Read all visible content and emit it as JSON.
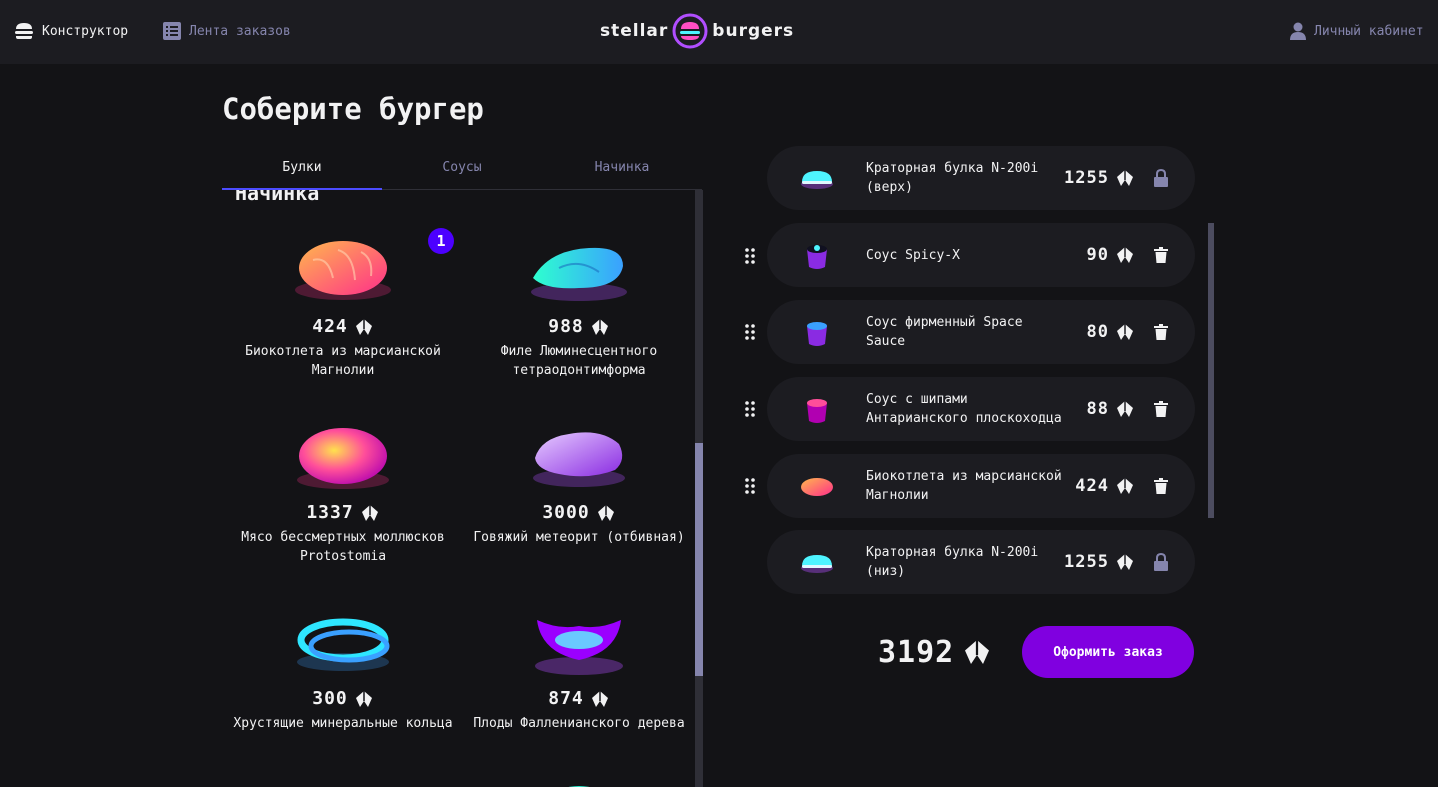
{
  "header": {
    "constructor_label": "Конструктор",
    "feed_label": "Лента заказов",
    "logo_left": "stellar",
    "logo_right": "burgers",
    "account_label": "Личный кабинет"
  },
  "main": {
    "title": "Соберите бургер",
    "tabs": [
      {
        "label": "Булки",
        "active": true
      },
      {
        "label": "Соусы",
        "active": false
      },
      {
        "label": "Начинка",
        "active": false
      }
    ],
    "section_title": "Начинка",
    "ingredients": [
      {
        "name": "Биокотлета из марсианской Магнолии",
        "price": "424",
        "count": "1"
      },
      {
        "name": "Филе Люминесцентного тетраодонтимформа",
        "price": "988"
      },
      {
        "name": "Мясо бессмертных моллюсков Protostomia",
        "price": "1337"
      },
      {
        "name": "Говяжий метеорит (отбивная)",
        "price": "3000"
      },
      {
        "name": "Хрустящие минеральные кольца",
        "price": "300"
      },
      {
        "name": "Плоды Фалленианского дерева",
        "price": "874"
      }
    ]
  },
  "constructor": {
    "top_bun": {
      "name": "Краторная булка N-200i (верх)",
      "price": "1255"
    },
    "items": [
      {
        "name": "Соус Spicy-X",
        "price": "90"
      },
      {
        "name": "Соус фирменный Space Sauce",
        "price": "80"
      },
      {
        "name": "Соус с шипами Антарианского плоскоходца",
        "price": "88"
      },
      {
        "name": "Биокотлета из марсианской Магнолии",
        "price": "424"
      }
    ],
    "bottom_bun": {
      "name": "Краторная булка N-200i (низ)",
      "price": "1255"
    },
    "total": "3192",
    "order_button": "Оформить заказ"
  },
  "colors": {
    "accent": "#4c4cff",
    "order_button": "#8000e0",
    "badge": "#4c00ff",
    "inactive_text": "#8585ad"
  }
}
